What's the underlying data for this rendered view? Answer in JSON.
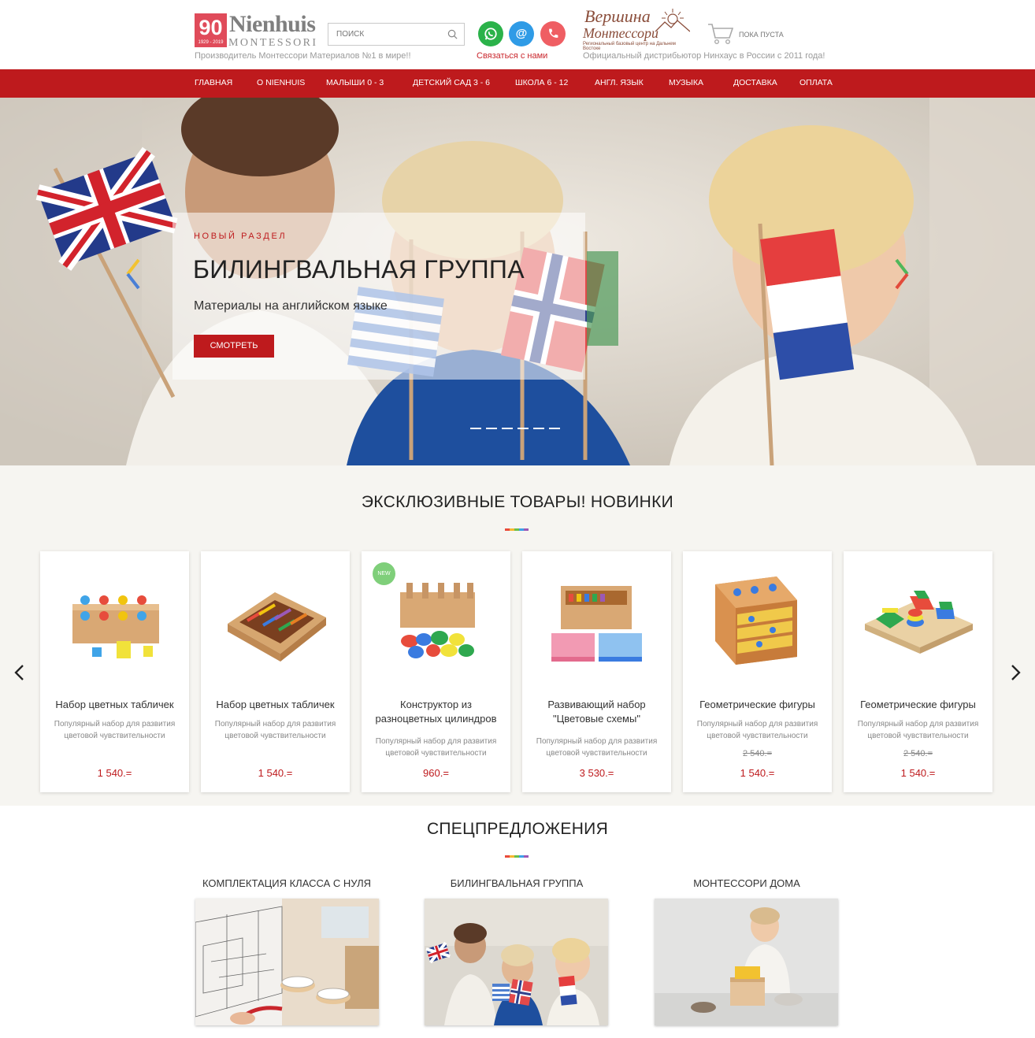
{
  "header": {
    "logo_badge": "90",
    "logo_badge_years": "1929 - 2019",
    "logo_name": "Nienhuis",
    "logo_sub": "MONTESSORI",
    "tagline": "Производитель Монтессори Материалов №1 в мире!!",
    "search_placeholder": "ПОИСК",
    "contact_label": "Связаться с нами",
    "partner_logo_line1": "Вершина",
    "partner_logo_line2": "Монтессори",
    "partner_logo_line3": "Региональный базовый центр на Дальнем Востоке",
    "distributor": "Официальный дистрибьютор Нинхаус в России с 2011 года!",
    "cart_label": "ПОКА ПУСТА"
  },
  "nav": [
    "ГЛАВНАЯ",
    "О NIENHUIS",
    "МАЛЫШИ  0 - 3",
    "ДЕТСКИЙ САД  3 - 6",
    "ШКОЛА  6 - 12",
    "АНГЛ. ЯЗЫК",
    "МУЗЫКА",
    "ДОСТАВКА",
    "ОПЛАТА"
  ],
  "hero": {
    "kicker": "НОВЫЙ РАЗДЕЛ",
    "title": "БИЛИНГВАЛЬНАЯ ГРУППА",
    "subtitle": "Материалы на английском языке",
    "button": "СМОТРЕТЬ",
    "slides": 6,
    "active_slide": 1
  },
  "products_section": {
    "title": "ЭКСКЛЮЗИВНЫЕ ТОВАРЫ!   НОВИНКИ",
    "items": [
      {
        "name": "Набор цветных табличек",
        "desc": "Популярный набор для развития цветовой чувствительности",
        "old_price": "",
        "price": "1 540.=",
        "badge": ""
      },
      {
        "name": "Набор цветных табличек",
        "desc": "Популярный набор для развития цветовой чувствительности",
        "old_price": "",
        "price": "1 540.=",
        "badge": ""
      },
      {
        "name": "Конструктор из разноцветных цилиндров",
        "desc": "Популярный набор для развития цветовой чувствительности",
        "old_price": "",
        "price": "960.=",
        "badge": "NEW"
      },
      {
        "name": "Развивающий набор \"Цветовые схемы\"",
        "desc": "Популярный набор для развития цветовой чувствительности",
        "old_price": "",
        "price": "3 530.=",
        "badge": ""
      },
      {
        "name": "Геометрические фигуры",
        "desc": "Популярный набор для развития цветовой чувствительности",
        "old_price": "2 540.=",
        "price": "1 540.=",
        "badge": ""
      },
      {
        "name": "Геометрические фигуры",
        "desc": "Популярный набор для развития цветовой чувствительности",
        "old_price": "2 540.=",
        "price": "1 540.=",
        "badge": ""
      }
    ]
  },
  "offers_section": {
    "title": "СПЕЦПРЕДЛОЖЕНИЯ",
    "items": [
      "КОМПЛЕКТАЦИЯ КЛАССА С НУЛЯ",
      "БИЛИНГВАЛЬНАЯ ГРУППА",
      "МОНТЕССОРИ ДОМА"
    ]
  },
  "colors": {
    "brand_red": "#be1a1d",
    "logo_pink": "#e04b5a",
    "whatsapp": "#2bb24a",
    "mail": "#2f9be6",
    "phone": "#ef5e63"
  }
}
